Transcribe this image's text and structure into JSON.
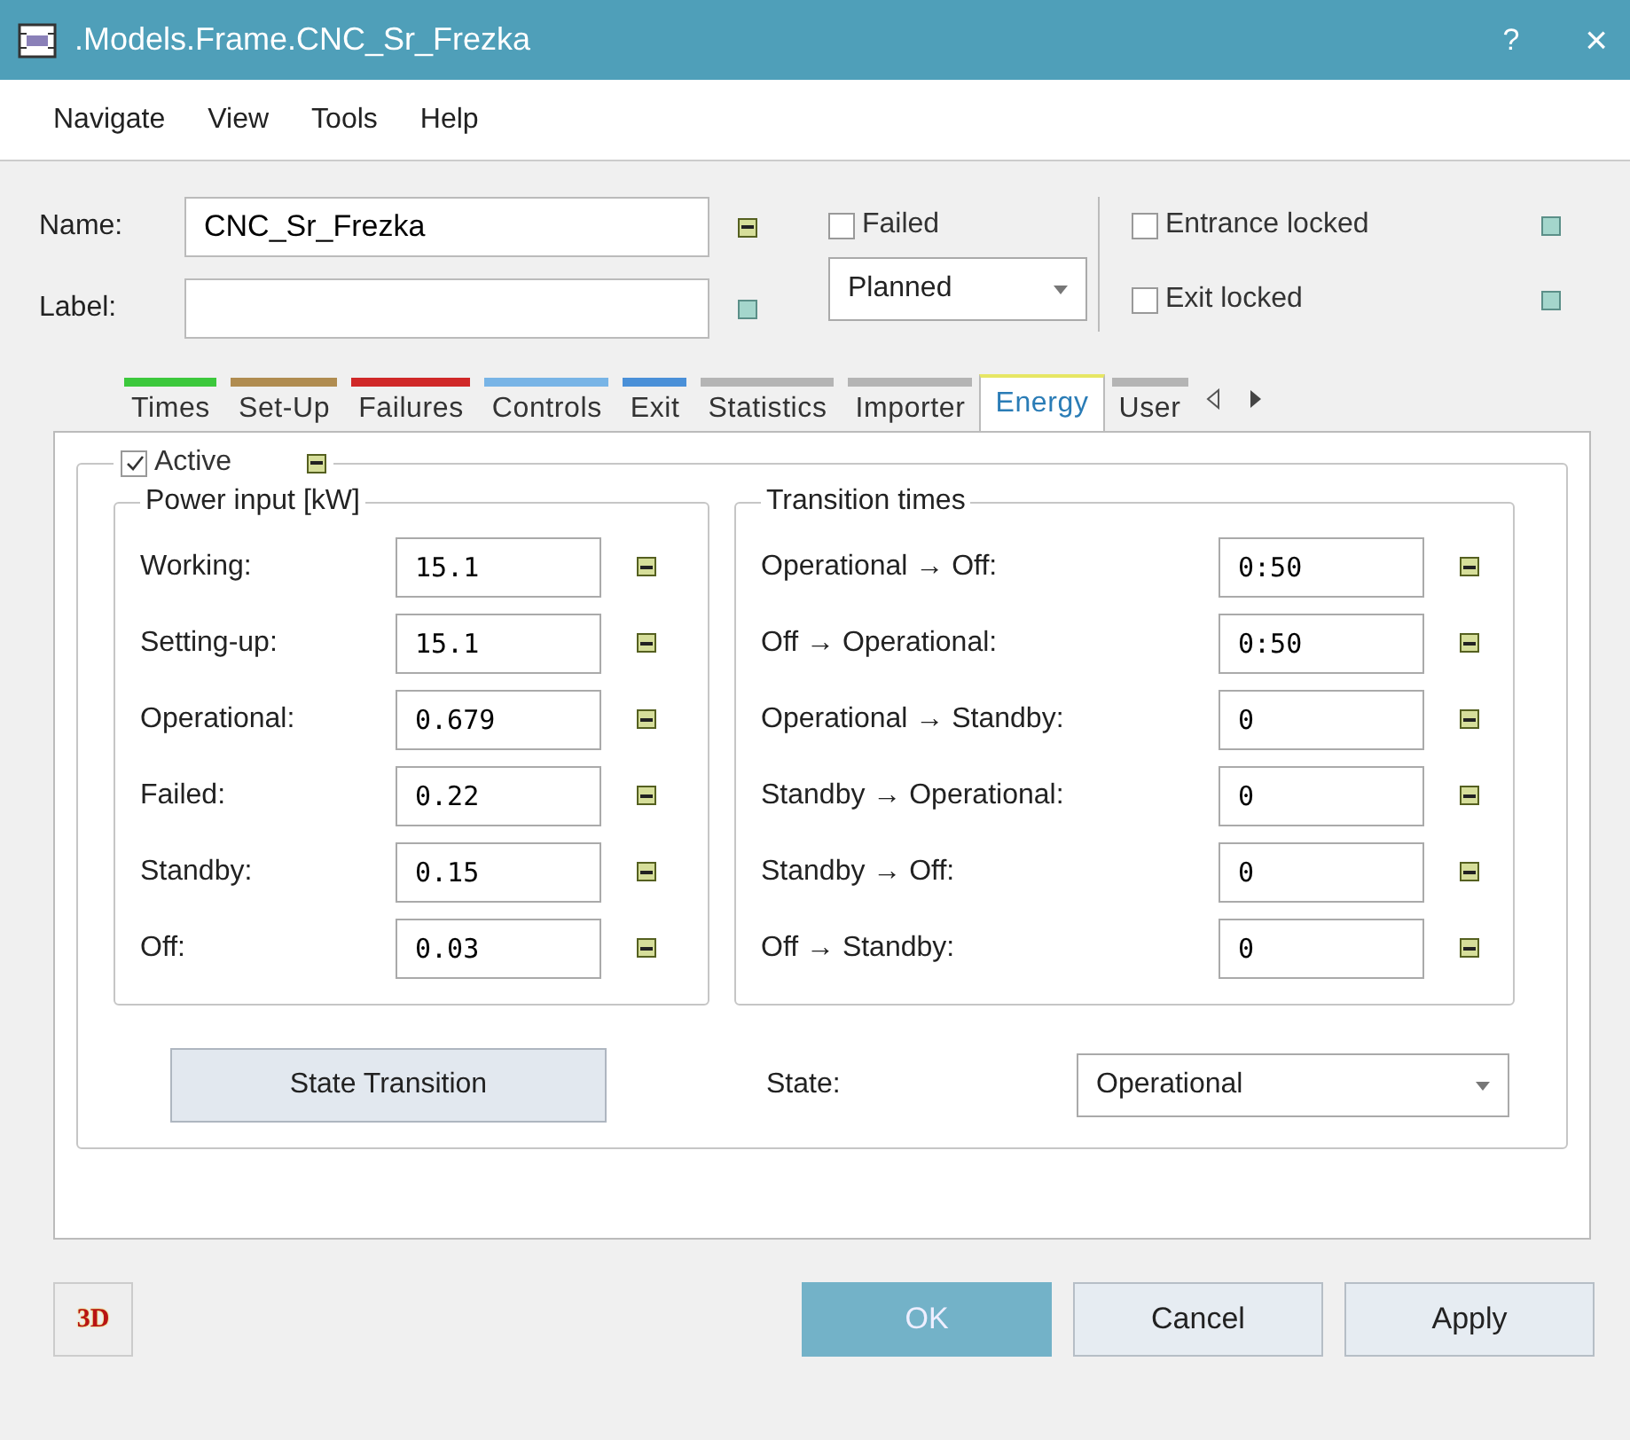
{
  "window": {
    "title": ".Models.Frame.CNC_Sr_Frezka",
    "help": "?",
    "close": "×"
  },
  "menu": [
    "Navigate",
    "View",
    "Tools",
    "Help"
  ],
  "header": {
    "name": {
      "label": "Name:",
      "value": "CNC_Sr_Frezka",
      "inherited": true
    },
    "label_field": {
      "label": "Label:",
      "inherited": false
    },
    "failed": {
      "label": "Failed",
      "checked": false
    },
    "status_dropdown": {
      "value": "Planned"
    },
    "entrance_locked": {
      "label": "Entrance locked",
      "checked": false,
      "inherited": false
    },
    "exit_locked": {
      "label": "Exit locked",
      "checked": false,
      "inherited": false
    }
  },
  "tabs": [
    {
      "label": "Times",
      "color": "#3cc83c",
      "selected": false
    },
    {
      "label": "Set-Up",
      "color": "#b08c50",
      "selected": false
    },
    {
      "label": "Failures",
      "color": "#d02828",
      "selected": false
    },
    {
      "label": "Controls",
      "color": "#78b4e6",
      "selected": false
    },
    {
      "label": "Exit",
      "color": "#4a90d8",
      "selected": false
    },
    {
      "label": "Statistics",
      "color": "#b4b4b4",
      "selected": false
    },
    {
      "label": "Importer",
      "color": "#b4b4b4",
      "selected": false
    },
    {
      "label": "Energy",
      "color": "#e6e664",
      "selected": true
    },
    {
      "label": "User",
      "color": "#b4b4b4",
      "selected": false
    }
  ],
  "energy": {
    "active": {
      "label": "Active",
      "checked": true,
      "inherited": true
    },
    "power_input": {
      "title": "Power input [kW]",
      "rows": [
        {
          "label": "Working:",
          "value": "15.1",
          "inherited": true
        },
        {
          "label": "Setting-up:",
          "value": "15.1",
          "inherited": true
        },
        {
          "label": "Operational:",
          "value": "0.679",
          "inherited": true
        },
        {
          "label": "Failed:",
          "value": "0.22",
          "inherited": true
        },
        {
          "label": "Standby:",
          "value": "0.15",
          "inherited": true
        },
        {
          "label": "Off:",
          "value": "0.03",
          "inherited": true
        }
      ]
    },
    "transition_times": {
      "title": "Transition times",
      "rows": [
        {
          "label": "Operational → Off:",
          "value": "0:50",
          "inherited": true
        },
        {
          "label": "Off → Operational:",
          "value": "0:50",
          "inherited": true
        },
        {
          "label": "Operational → Standby:",
          "value": "0",
          "inherited": true
        },
        {
          "label": "Standby → Operational:",
          "value": "0",
          "inherited": true
        },
        {
          "label": "Standby → Off:",
          "value": "0",
          "inherited": true
        },
        {
          "label": "Off → Standby:",
          "value": "0",
          "inherited": true
        }
      ]
    },
    "state_transition_button": "State Transition",
    "state": {
      "label": "State:",
      "value": "Operational"
    }
  },
  "buttons": {
    "three_d": "3D",
    "ok": "OK",
    "cancel": "Cancel",
    "apply": "Apply"
  }
}
